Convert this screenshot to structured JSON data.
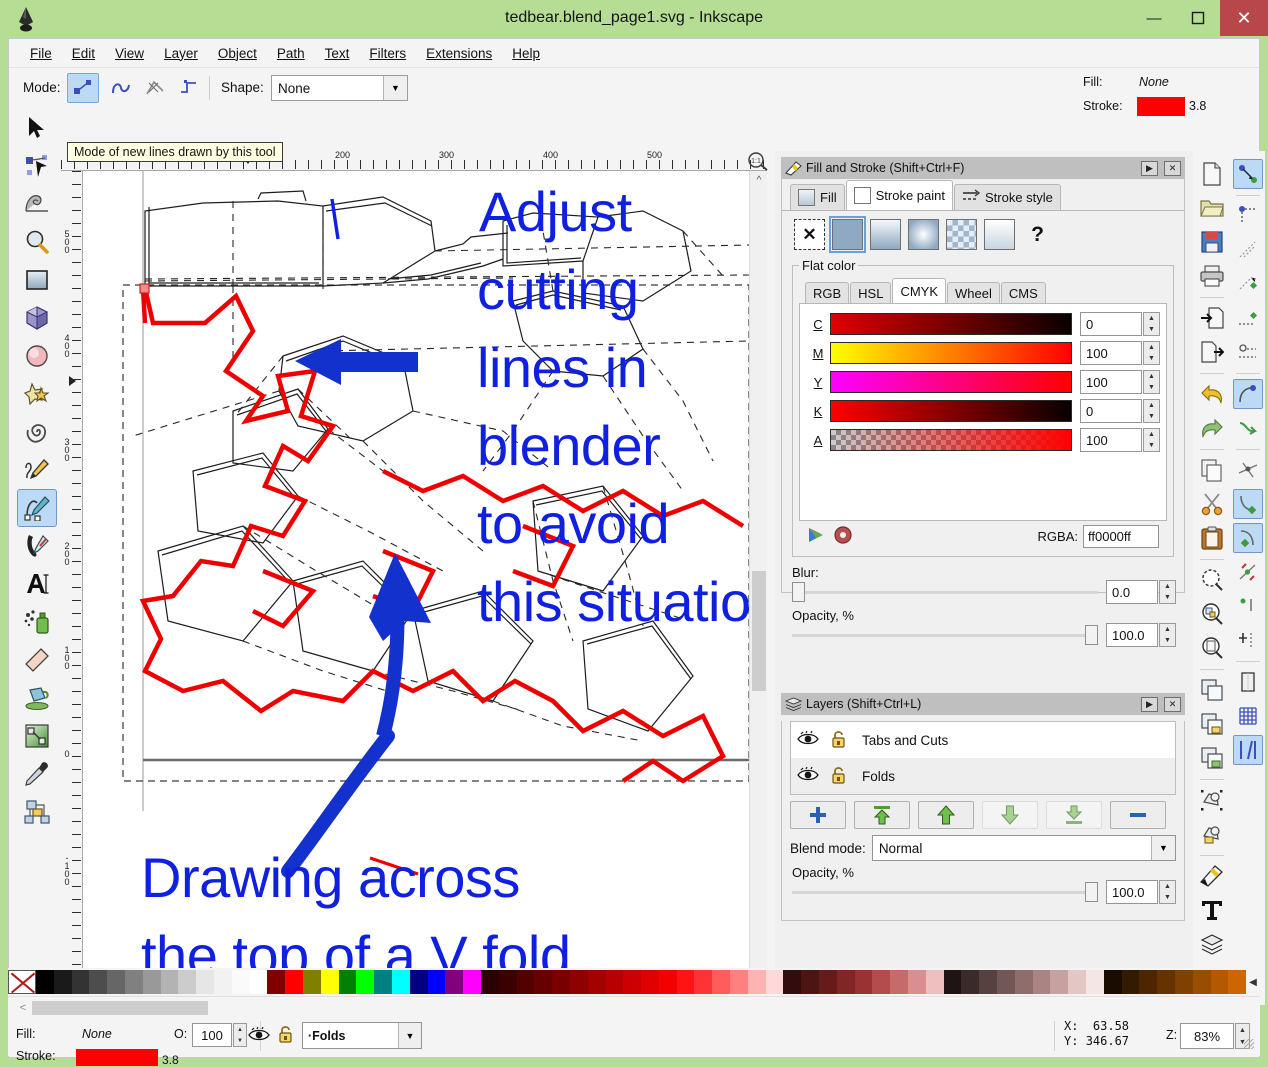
{
  "window": {
    "title": "tedbear.blend_page1.svg - Inkscape",
    "minimize_label": "—",
    "maximize_label": "❐",
    "close_label": "✕"
  },
  "menubar": {
    "items": [
      "File",
      "Edit",
      "View",
      "Layer",
      "Object",
      "Path",
      "Text",
      "Filters",
      "Extensions",
      "Help"
    ]
  },
  "toolopts": {
    "mode_label": "Mode:",
    "shape_label": "Shape:",
    "shape_value": "None",
    "mode_icons": [
      "bezier-mode-icon",
      "spiro-mode-icon",
      "straight-mode-icon",
      "paraxial-mode-icon"
    ],
    "tooltip": "Mode of new lines drawn by this tool",
    "fill_label": "Fill:",
    "fill_value": "None",
    "stroke_label": "Stroke:",
    "stroke_color": "#ff0000",
    "stroke_width": "3.8"
  },
  "toolbox": {
    "tools": [
      {
        "name": "selector-tool",
        "icon": "arrow-pointer-icon"
      },
      {
        "name": "node-tool",
        "icon": "node-editor-icon"
      },
      {
        "name": "tweak-tool",
        "icon": "tweak-wave-icon"
      },
      {
        "name": "zoom-tool",
        "icon": "magnifier-icon"
      },
      {
        "name": "rectangle-tool",
        "icon": "rectangle-icon"
      },
      {
        "name": "3dbox-tool",
        "icon": "cube-icon"
      },
      {
        "name": "ellipse-tool",
        "icon": "ellipse-icon"
      },
      {
        "name": "star-tool",
        "icon": "star-icon"
      },
      {
        "name": "spiral-tool",
        "icon": "spiral-icon"
      },
      {
        "name": "pencil-tool",
        "icon": "pencil-icon"
      },
      {
        "name": "bezier-pen-tool",
        "icon": "bezier-pen-icon"
      },
      {
        "name": "calligraphy-tool",
        "icon": "calligraphy-pen-icon"
      },
      {
        "name": "text-tool",
        "icon": "text-A-icon"
      },
      {
        "name": "spray-tool",
        "icon": "spray-can-icon"
      },
      {
        "name": "eraser-tool",
        "icon": "eraser-icon"
      },
      {
        "name": "bucket-fill-tool",
        "icon": "paint-bucket-icon"
      },
      {
        "name": "gradient-tool",
        "icon": "gradient-icon"
      },
      {
        "name": "dropper-tool",
        "icon": "eyedropper-icon"
      },
      {
        "name": "connector-tool",
        "icon": "connector-icon"
      }
    ],
    "selected_index": 10
  },
  "rulers": {
    "horizontal_labels": [
      "200",
      "300",
      "400",
      "500"
    ],
    "vertical_labels": [
      "500",
      "400",
      "300",
      "200",
      "100",
      "0",
      "-100"
    ]
  },
  "canvas": {
    "annotations": [
      {
        "name": "annotation-adjust",
        "lines": [
          "Adjust",
          "cutting",
          "lines in",
          "blender",
          "to avoid",
          "this situation"
        ],
        "color": "#1020e0"
      },
      {
        "name": "annotation-drawing",
        "lines": [
          "Drawing across",
          "the top of a V fold"
        ],
        "color": "#1020e0"
      }
    ],
    "arrow_up_name": "blue-curved-arrow-up",
    "arrow_left_name": "blue-arrow-left",
    "cut_line_color": "#ee0000",
    "fold_line_color": "#000000"
  },
  "fill_and_stroke": {
    "title": "Fill and Stroke (Shift+Ctrl+F)",
    "dock_btn": "▶",
    "close_btn": "✕",
    "tabs": [
      {
        "label": "Fill",
        "active": false,
        "name": "tab-fill"
      },
      {
        "label": "Stroke paint",
        "active": true,
        "name": "tab-stroke-paint"
      },
      {
        "label": "Stroke style",
        "active": false,
        "name": "tab-stroke-style"
      }
    ],
    "paint_types": [
      {
        "name": "paint-none",
        "glyph": "✕",
        "selected": false
      },
      {
        "name": "paint-flat-color",
        "glyph": "",
        "selected": true
      },
      {
        "name": "paint-linear-gradient",
        "glyph": "",
        "selected": false
      },
      {
        "name": "paint-radial-gradient",
        "glyph": "",
        "selected": false
      },
      {
        "name": "paint-pattern",
        "glyph": "",
        "selected": false
      },
      {
        "name": "paint-swatch",
        "glyph": "",
        "selected": false
      },
      {
        "name": "paint-unknown",
        "glyph": "?",
        "selected": false
      }
    ],
    "group_label": "Flat color",
    "color_tabs": [
      {
        "label": "RGB",
        "active": false
      },
      {
        "label": "HSL",
        "active": false
      },
      {
        "label": "CMYK",
        "active": true
      },
      {
        "label": "Wheel",
        "active": false
      },
      {
        "label": "CMS",
        "active": false
      }
    ],
    "channels": [
      {
        "key": "C",
        "value": "0"
      },
      {
        "key": "M",
        "value": "100"
      },
      {
        "key": "Y",
        "value": "100"
      },
      {
        "key": "K",
        "value": "0"
      },
      {
        "key": "A",
        "value": "100"
      }
    ],
    "rgba_label": "RGBA:",
    "rgba_value": "ff0000ff",
    "blur_label": "Blur:",
    "blur_value": "0.0",
    "opacity_label": "Opacity, %",
    "opacity_value": "100.0"
  },
  "layers": {
    "title": "Layers (Shift+Ctrl+L)",
    "dock_btn": "▶",
    "close_btn": "✕",
    "rows": [
      {
        "name": "Tabs and Cuts",
        "visible_icon": "eye-icon",
        "lock_icon": "unlock-icon"
      },
      {
        "name": "Folds",
        "visible_icon": "eye-icon",
        "lock_icon": "unlock-icon"
      }
    ],
    "buttons": [
      {
        "name": "add-layer-button",
        "glyph": "+"
      },
      {
        "name": "raise-to-top-button",
        "glyph": "⇧"
      },
      {
        "name": "raise-layer-button",
        "glyph": "↑"
      },
      {
        "name": "lower-layer-button",
        "glyph": "↓"
      },
      {
        "name": "lower-to-bottom-button",
        "glyph": "⇩"
      },
      {
        "name": "delete-layer-button",
        "glyph": "−"
      }
    ],
    "blend_label": "Blend mode:",
    "blend_value": "Normal",
    "opacity_label": "Opacity, %",
    "opacity_value": "100.0"
  },
  "command_bar": {
    "buttons": [
      {
        "name": "new-document-button",
        "icon": "page-icon"
      },
      {
        "name": "open-document-button",
        "icon": "folder-icon"
      },
      {
        "name": "save-document-button",
        "icon": "floppy-icon"
      },
      {
        "name": "print-button",
        "icon": "printer-icon"
      },
      {
        "name": "import-button",
        "icon": "import-icon"
      },
      {
        "name": "export-button",
        "icon": "export-icon"
      },
      {
        "name": "undo-button",
        "icon": "undo-arrow-icon"
      },
      {
        "name": "redo-button",
        "icon": "redo-arrow-icon"
      },
      {
        "name": "copy-button",
        "icon": "copy-icon"
      },
      {
        "name": "cut-button",
        "icon": "scissors-icon"
      },
      {
        "name": "paste-button",
        "icon": "clipboard-icon"
      },
      {
        "name": "zoom-selection-button",
        "icon": "zoom-selection-icon"
      },
      {
        "name": "zoom-drawing-button",
        "icon": "zoom-drawing-icon"
      },
      {
        "name": "zoom-page-button",
        "icon": "zoom-page-icon"
      },
      {
        "name": "duplicate-button",
        "icon": "duplicate-icon"
      },
      {
        "name": "group-button",
        "icon": "group-lock-icon"
      },
      {
        "name": "ungroup-button",
        "icon": "ungroup-icon"
      },
      {
        "name": "object-to-path-button",
        "icon": "object-path-icon"
      },
      {
        "name": "stroke-to-path-button",
        "icon": "stroke-path-icon"
      },
      {
        "name": "fill-stroke-dialog-button",
        "icon": "fill-stroke-icon"
      },
      {
        "name": "text-dialog-button",
        "icon": "text-T-icon"
      },
      {
        "name": "layers-dialog-button",
        "icon": "layers-stack-icon"
      }
    ],
    "overflow_label": "»"
  },
  "snap_bar": {
    "buttons": [
      {
        "name": "enable-snapping-button",
        "icon": "snap-node-icon",
        "selected": true
      },
      {
        "name": "snap-bounding-box-button",
        "icon": "snap-bbox-icon",
        "selected": false
      },
      {
        "name": "snap-bbox-edge-button",
        "icon": "snap-bbox-edge-icon",
        "selected": false
      },
      {
        "name": "snap-bbox-corner-button",
        "icon": "snap-bbox-corner-icon",
        "selected": false
      },
      {
        "name": "snap-bbox-edge-midpoint-button",
        "icon": "snap-edge-mid-icon",
        "selected": false
      },
      {
        "name": "snap-bbox-center-button",
        "icon": "snap-bbox-center-icon",
        "selected": false
      },
      {
        "name": "snap-nodes-paths-button",
        "icon": "snap-nodes-icon",
        "selected": true
      },
      {
        "name": "snap-path-button",
        "icon": "snap-path-icon",
        "selected": false
      },
      {
        "name": "snap-path-intersection-button",
        "icon": "snap-intersect-icon",
        "selected": false
      },
      {
        "name": "snap-cusp-node-button",
        "icon": "snap-cusp-icon",
        "selected": true
      },
      {
        "name": "snap-smooth-node-button",
        "icon": "snap-smooth-icon",
        "selected": true
      },
      {
        "name": "snap-midpoint-button",
        "icon": "snap-midpoint-icon",
        "selected": false
      },
      {
        "name": "snap-object-center-button",
        "icon": "snap-center-icon",
        "selected": false
      },
      {
        "name": "snap-rotation-center-button",
        "icon": "snap-rotation-icon",
        "selected": false
      },
      {
        "name": "snap-page-border-button",
        "icon": "snap-page-icon",
        "selected": false
      },
      {
        "name": "snap-grid-button",
        "icon": "snap-grid-icon",
        "selected": false
      },
      {
        "name": "snap-guide-button",
        "icon": "snap-guide-icon",
        "selected": true
      }
    ]
  },
  "palette": {
    "none_swatch_name": "palette-none-swatch",
    "left_arrow": "◀",
    "right_arrow": "▶",
    "colors": [
      "#000000",
      "#1a1a1a",
      "#333333",
      "#4d4d4d",
      "#666666",
      "#808080",
      "#999999",
      "#b3b3b3",
      "#cccccc",
      "#e6e6e6",
      "#f2f2f2",
      "#fafafa",
      "#ffffff",
      "#800000",
      "#ff0000",
      "#808000",
      "#ffff00",
      "#008000",
      "#00ff00",
      "#008080",
      "#00ffff",
      "#000080",
      "#0000ff",
      "#800080",
      "#ff00ff",
      "#2b0000",
      "#3d0000",
      "#520000",
      "#660000",
      "#7a0000",
      "#8f0000",
      "#a30000",
      "#b80000",
      "#cc0000",
      "#e00000",
      "#f50000",
      "#ff1414",
      "#ff3333",
      "#ff5c5c",
      "#ff8080",
      "#ffb3b3",
      "#ffd9d9",
      "#330d0d",
      "#4d1414",
      "#661a1a",
      "#802626",
      "#993333",
      "#b34d4d",
      "#c66b6b",
      "#d98f8f",
      "#edbfbf",
      "#1f1414",
      "#3b2a2a",
      "#574040",
      "#735656",
      "#8f6d6d",
      "#ab8383",
      "#c7a0a0",
      "#e3c7c7",
      "#f5e6e6",
      "#1a0d00",
      "#331a00",
      "#4d2600",
      "#663300",
      "#804000",
      "#994d00",
      "#b35900",
      "#cc6600"
    ]
  },
  "statusbar": {
    "fill_label": "Fill:",
    "fill_value": "None",
    "stroke_label": "Stroke:",
    "stroke_color": "#ff0000",
    "stroke_width": "3.8",
    "opacity_label": "O:",
    "opacity_value": "100",
    "visible_icon": "eye-icon",
    "lock_icon": "unlock-icon",
    "layer_value": "·Folds",
    "x_label": "X:",
    "x_value": "63.58",
    "y_label": "Y:",
    "y_value": "346.67",
    "zoom_label": "Z:",
    "zoom_value": "83%"
  }
}
